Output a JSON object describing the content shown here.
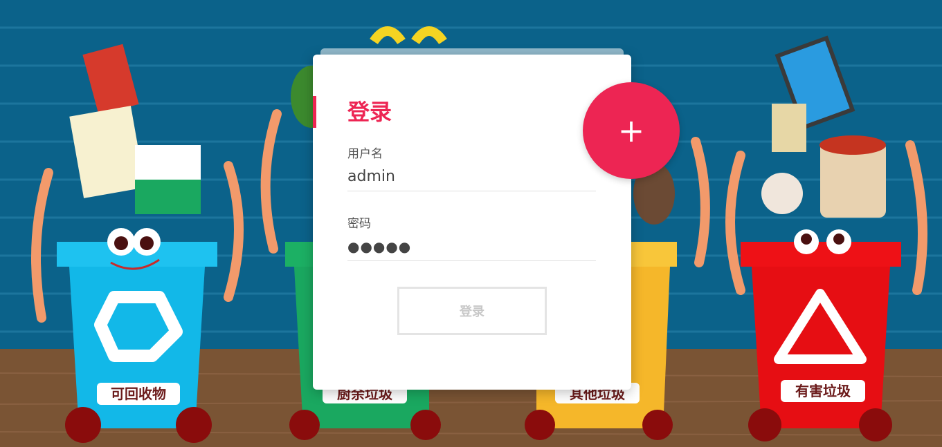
{
  "login": {
    "title": "登录",
    "username_label": "用户名",
    "username_value": "admin",
    "password_label": "密码",
    "password_value": "●●●●●",
    "submit_label": "登录",
    "toggle_label": "+"
  },
  "bins": [
    {
      "label": "可回收物",
      "color": "#12b8e8"
    },
    {
      "label": "厨余垃圾",
      "color": "#1aa860"
    },
    {
      "label": "其他垃圾",
      "color": "#f5b72a"
    },
    {
      "label": "有害垃圾",
      "color": "#e60e13"
    }
  ],
  "colors": {
    "accent": "#ed2553",
    "wall": "#0b628a",
    "floor": "#7a5434"
  }
}
